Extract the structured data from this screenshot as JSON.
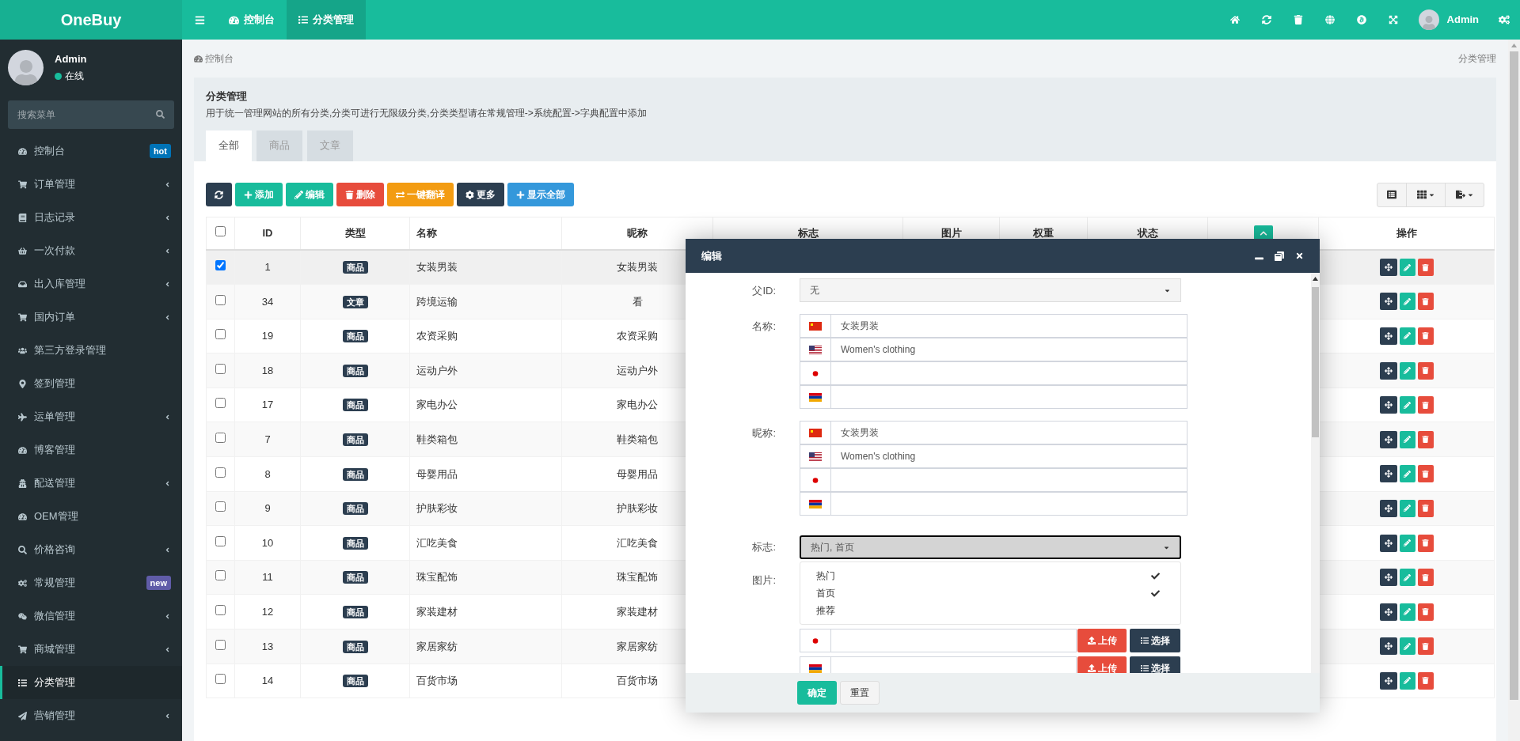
{
  "app": {
    "logo": "OneBuy"
  },
  "topbar": {
    "nav": [
      {
        "label": "控制台",
        "selected": false
      },
      {
        "label": "分类管理",
        "selected": true
      }
    ],
    "user": "Admin"
  },
  "sidebar": {
    "user": {
      "name": "Admin",
      "status": "在线"
    },
    "search": {
      "placeholder": "搜索菜单"
    },
    "items": [
      {
        "label": "控制台",
        "expandable": false,
        "selected": false,
        "badge": {
          "text": "hot",
          "color": "#0073b7"
        }
      },
      {
        "label": "订单管理",
        "expandable": true,
        "selected": false
      },
      {
        "label": "日志记录",
        "expandable": true,
        "selected": false
      },
      {
        "label": "一次付款",
        "expandable": true,
        "selected": false
      },
      {
        "label": "出入库管理",
        "expandable": true,
        "selected": false
      },
      {
        "label": "国内订单",
        "expandable": true,
        "selected": false
      },
      {
        "label": "第三方登录管理",
        "expandable": false,
        "selected": false
      },
      {
        "label": "签到管理",
        "expandable": false,
        "selected": false
      },
      {
        "label": "运单管理",
        "expandable": true,
        "selected": false
      },
      {
        "label": "博客管理",
        "expandable": false,
        "selected": false
      },
      {
        "label": "配送管理",
        "expandable": true,
        "selected": false
      },
      {
        "label": "OEM管理",
        "expandable": false,
        "selected": false
      },
      {
        "label": "价格咨询",
        "expandable": true,
        "selected": false
      },
      {
        "label": "常规管理",
        "expandable": false,
        "selected": false,
        "badge": {
          "text": "new",
          "color": "#605ca8"
        }
      },
      {
        "label": "微信管理",
        "expandable": true,
        "selected": false
      },
      {
        "label": "商城管理",
        "expandable": true,
        "selected": false
      },
      {
        "label": "分类管理",
        "expandable": false,
        "selected": true
      },
      {
        "label": "营销管理",
        "expandable": true,
        "selected": false
      }
    ]
  },
  "breadcrumb": {
    "home": "控制台",
    "current": "分类管理"
  },
  "panel": {
    "title": "分类管理",
    "description": "用于统一管理网站的所有分类,分类可进行无限级分类,分类类型请在常规管理->系统配置->字典配置中添加",
    "tabs": [
      {
        "label": "全部",
        "selected": true
      },
      {
        "label": "商品",
        "selected": false
      },
      {
        "label": "文章",
        "selected": false
      }
    ]
  },
  "toolbar": [
    {
      "color": "#2c3e50"
    },
    {
      "label": "添加",
      "color": "#18bc9c"
    },
    {
      "label": "编辑",
      "color": "#18bc9c"
    },
    {
      "label": "删除",
      "color": "#e74c3c"
    },
    {
      "label": "一键翻译",
      "color": "#f39c12"
    },
    {
      "label": "更多",
      "color": "#2c3e50"
    },
    {
      "label": "显示全部",
      "color": "#3498db"
    }
  ],
  "table": {
    "all_checked": false,
    "columns": [
      "ID",
      "类型",
      "名称",
      "昵称",
      "标志",
      "图片",
      "权重",
      "状态",
      "操作"
    ],
    "rows": [
      {
        "checked": true,
        "id": "1",
        "type": "商品",
        "name": "女装男装",
        "nickname": "女装男装"
      },
      {
        "checked": false,
        "id": "34",
        "type": "文章",
        "name": "跨境运输",
        "nickname": "看"
      },
      {
        "checked": false,
        "id": "19",
        "type": "商品",
        "name": "农资采购",
        "nickname": "农资采购"
      },
      {
        "checked": false,
        "id": "18",
        "type": "商品",
        "name": "运动户外",
        "nickname": "运动户外"
      },
      {
        "checked": false,
        "id": "17",
        "type": "商品",
        "name": "家电办公",
        "nickname": "家电办公"
      },
      {
        "checked": false,
        "id": "7",
        "type": "商品",
        "name": "鞋类箱包",
        "nickname": "鞋类箱包"
      },
      {
        "checked": false,
        "id": "8",
        "type": "商品",
        "name": "母婴用品",
        "nickname": "母婴用品"
      },
      {
        "checked": false,
        "id": "9",
        "type": "商品",
        "name": "护肤彩妆",
        "nickname": "护肤彩妆"
      },
      {
        "checked": false,
        "id": "10",
        "type": "商品",
        "name": "汇吃美食",
        "nickname": "汇吃美食"
      },
      {
        "checked": false,
        "id": "11",
        "type": "商品",
        "name": "珠宝配饰",
        "nickname": "珠宝配饰"
      },
      {
        "checked": false,
        "id": "12",
        "type": "商品",
        "name": "家装建材",
        "nickname": "家装建材"
      },
      {
        "checked": false,
        "id": "13",
        "type": "商品",
        "name": "家居家纺",
        "nickname": "家居家纺"
      },
      {
        "checked": false,
        "id": "14",
        "type": "商品",
        "name": "百货市场",
        "nickname": "百货市场"
      }
    ]
  },
  "dialog": {
    "title": "编辑",
    "parent": {
      "label": "父ID:",
      "value": "无"
    },
    "name": {
      "label": "名称:",
      "fields": [
        {
          "value": "女装男装"
        },
        {
          "value": "Women's clothing"
        }
      ]
    },
    "nickname": {
      "label": "昵称:",
      "fields": [
        {
          "value": "女装男装"
        },
        {
          "value": "Women's clothing"
        }
      ]
    },
    "flags": {
      "label": "标志:",
      "value": "热门, 首页",
      "expanded": true,
      "options": [
        {
          "label": "热门",
          "checked": true
        },
        {
          "label": "首页",
          "checked": true
        },
        {
          "label": "推荐",
          "checked": false
        }
      ]
    },
    "image": {
      "label": "图片:",
      "rows": [
        {
          "upload": "上传",
          "choose": "选择"
        },
        {
          "upload": "上传",
          "choose": "选择"
        }
      ]
    },
    "buttons": {
      "submit": "确定",
      "reset": "重置"
    }
  }
}
